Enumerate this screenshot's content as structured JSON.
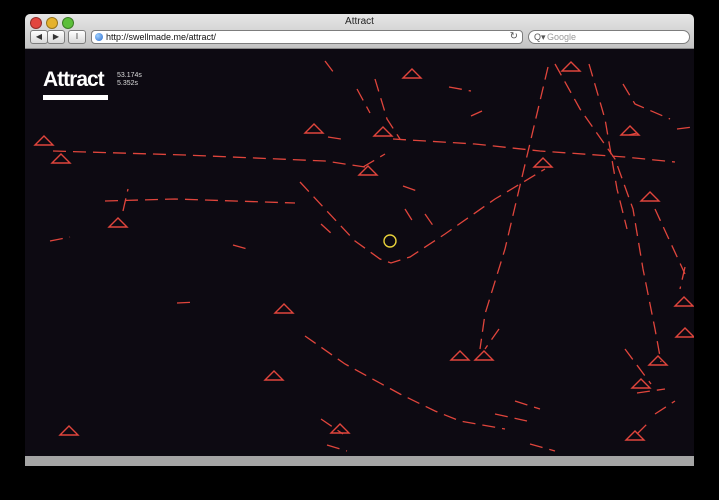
{
  "browser": {
    "window_title": "Attract",
    "url": "http://swellmade.me/attract/",
    "search_placeholder": "Google",
    "back_glyph": "◀",
    "forward_glyph": "▶",
    "reader_glyph": "I",
    "reload_glyph": "↻",
    "search_glyph": "Q▾"
  },
  "game": {
    "title": "Attract",
    "stat_primary": "53.174s",
    "stat_secondary": "5.352s",
    "colors": {
      "background": "#0d0a12",
      "trail": "#e0453c",
      "player": "#e8d23a"
    },
    "icons": {
      "enemy": "triangle-outline-icon",
      "player": "ring-icon"
    }
  }
}
